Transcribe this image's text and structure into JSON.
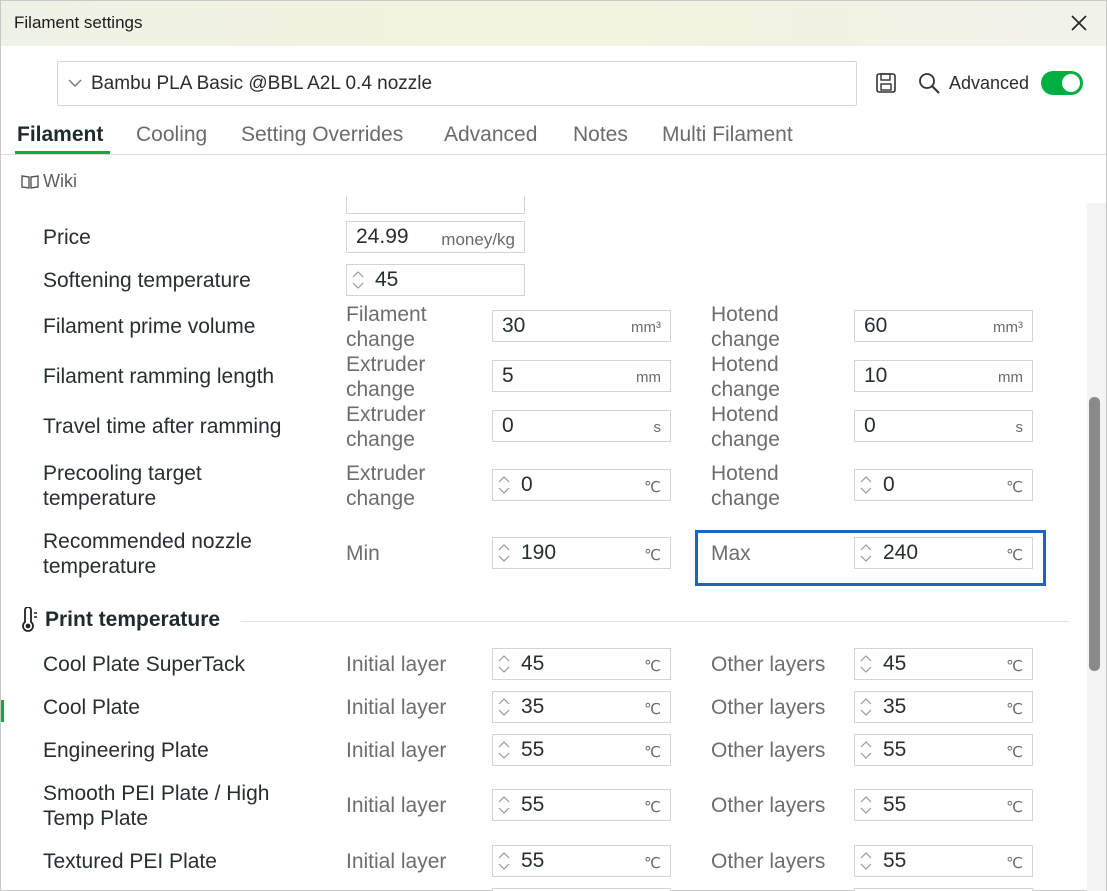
{
  "window": {
    "title": "Filament settings"
  },
  "preset": {
    "value": "Bambu PLA Basic @BBL A2L 0.4 nozzle"
  },
  "toolbar": {
    "advanced_label": "Advanced",
    "advanced_on": true
  },
  "tabs": [
    {
      "label": "Filament",
      "active": true
    },
    {
      "label": "Cooling"
    },
    {
      "label": "Setting Overrides"
    },
    {
      "label": "Advanced"
    },
    {
      "label": "Notes"
    },
    {
      "label": "Multi Filament"
    }
  ],
  "wiki": {
    "label": "Wiki"
  },
  "rows": {
    "price": {
      "label": "Price",
      "value": "24.99",
      "unit": "money/kg"
    },
    "softening": {
      "label": "Softening temperature",
      "value": "45"
    },
    "prime_volume": {
      "label": "Filament prime volume",
      "left_sub": [
        "Filament",
        "change"
      ],
      "left_value": "30",
      "left_unit": "mm³",
      "right_sub": [
        "Hotend",
        "change"
      ],
      "right_value": "60",
      "right_unit": "mm³"
    },
    "ramming_length": {
      "label": "Filament ramming length",
      "left_sub": [
        "Extruder",
        "change"
      ],
      "left_value": "5",
      "left_unit": "mm",
      "right_sub": [
        "Hotend",
        "change"
      ],
      "right_value": "10",
      "right_unit": "mm"
    },
    "travel_time": {
      "label": "Travel time after ramming",
      "left_sub": [
        "Extruder",
        "change"
      ],
      "left_value": "0",
      "left_unit": "s",
      "right_sub": [
        "Hotend",
        "change"
      ],
      "right_value": "0",
      "right_unit": "s"
    },
    "precooling": {
      "label": [
        "Precooling target",
        "temperature"
      ],
      "left_sub": [
        "Extruder",
        "change"
      ],
      "left_value": "0",
      "left_unit": "℃",
      "right_sub": [
        "Hotend",
        "change"
      ],
      "right_value": "0",
      "right_unit": "℃"
    },
    "nozzle_temp": {
      "label": [
        "Recommended nozzle",
        "temperature"
      ],
      "left_sub": "Min",
      "left_value": "190",
      "left_unit": "℃",
      "right_sub": "Max",
      "right_value": "240",
      "right_unit": "℃"
    }
  },
  "print_temperature": {
    "title": "Print temperature",
    "initial_label": "Initial layer",
    "other_label": "Other layers",
    "unit": "℃",
    "plates": [
      {
        "label": [
          "Cool Plate SuperTack"
        ],
        "initial": "45",
        "other": "45"
      },
      {
        "label": [
          "Cool Plate"
        ],
        "initial": "35",
        "other": "35"
      },
      {
        "label": [
          "Engineering Plate"
        ],
        "initial": "55",
        "other": "55"
      },
      {
        "label": [
          "Smooth PEI Plate / High",
          "Temp Plate"
        ],
        "initial": "55",
        "other": "55"
      },
      {
        "label": [
          "Textured PEI Plate"
        ],
        "initial": "55",
        "other": "55"
      }
    ]
  }
}
